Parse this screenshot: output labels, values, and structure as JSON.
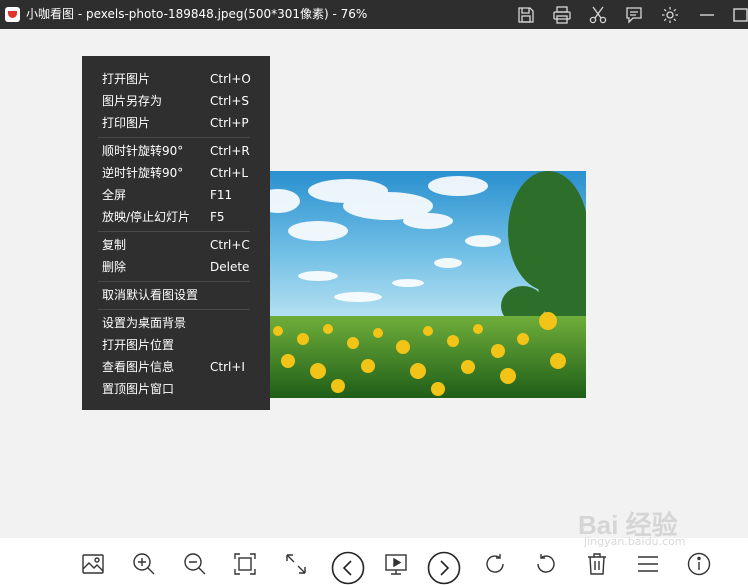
{
  "window": {
    "title": "小咖看图 - pexels-photo-189848.jpeg(500*301像素) - 76%"
  },
  "titlebar_icons": [
    "save-icon",
    "print-icon",
    "cut-icon",
    "comment-icon",
    "settings-icon",
    "minimize-icon",
    "maximize-icon"
  ],
  "menu": {
    "items": [
      {
        "label": "打开图片",
        "shortcut": "Ctrl+O"
      },
      {
        "label": "图片另存为",
        "shortcut": "Ctrl+S"
      },
      {
        "label": "打印图片",
        "shortcut": "Ctrl+P"
      },
      {
        "label": "顺时针旋转90°",
        "shortcut": "Ctrl+R"
      },
      {
        "label": "逆时针旋转90°",
        "shortcut": "Ctrl+L"
      },
      {
        "label": "全屏",
        "shortcut": "F11"
      },
      {
        "label": "放映/停止幻灯片",
        "shortcut": "F5"
      },
      {
        "label": "复制",
        "shortcut": "Ctrl+C"
      },
      {
        "label": "删除",
        "shortcut": "Delete"
      },
      {
        "label": "取消默认看图设置",
        "shortcut": ""
      },
      {
        "label": "设置为桌面背景",
        "shortcut": ""
      },
      {
        "label": "打开图片位置",
        "shortcut": ""
      },
      {
        "label": "查看图片信息",
        "shortcut": "Ctrl+I"
      },
      {
        "label": "置顶图片窗口",
        "shortcut": ""
      }
    ]
  },
  "toolbar_icons": [
    "image-icon",
    "zoom-in-icon",
    "zoom-out-icon",
    "fit-window-icon",
    "full-size-icon",
    "previous-icon",
    "slideshow-icon",
    "next-icon",
    "rotate-clockwise-icon",
    "rotate-counterclockwise-icon",
    "delete-icon",
    "menu-icon",
    "info-icon"
  ],
  "watermark": {
    "text": "Bai 经验",
    "url": "jingyan.baidu.com"
  },
  "colors": {
    "titlebar": "#2e2e2e",
    "menu_bg": "#2f2f2f",
    "canvas_bg": "#f2f2f2",
    "toolbar_bg": "#ffffff"
  }
}
